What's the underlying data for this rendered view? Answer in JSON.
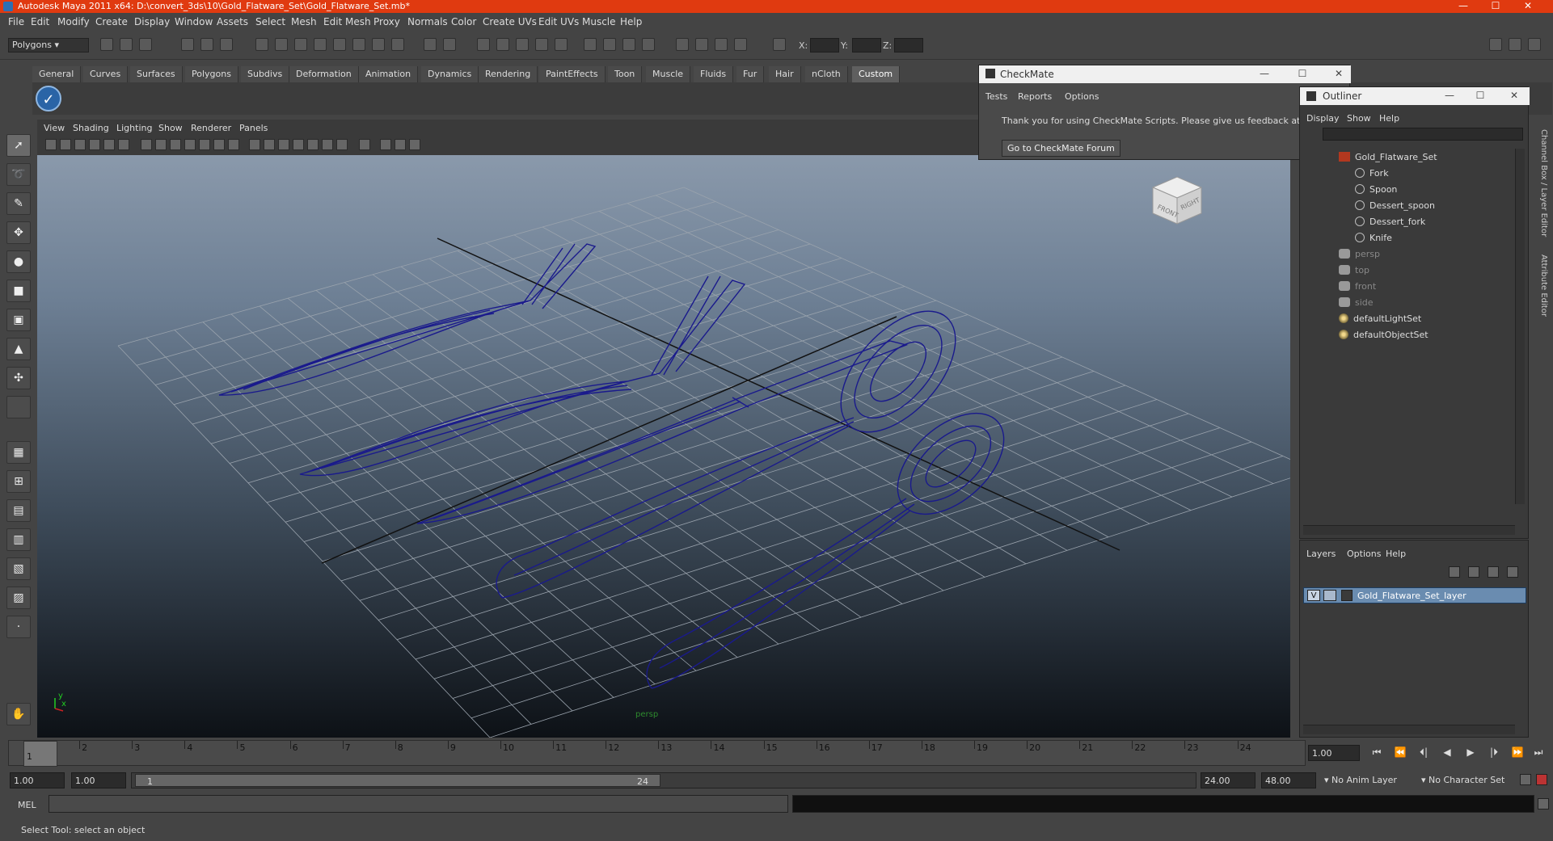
{
  "window": {
    "title": "Autodesk Maya 2011 x64: D:\\convert_3ds\\10\\Gold_Flatware_Set\\Gold_Flatware_Set.mb*",
    "minimize": "—",
    "maximize": "☐",
    "close": "✕"
  },
  "menubar": [
    "File",
    "Edit",
    "Modify",
    "Create",
    "Display",
    "Window",
    "Assets",
    "Select",
    "Mesh",
    "Edit Mesh",
    "Proxy",
    "Normals",
    "Color",
    "Create UVs",
    "Edit UVs",
    "Muscle",
    "Help"
  ],
  "statusline": {
    "mode": "Polygons",
    "x_label": "X:",
    "y_label": "Y:",
    "z_label": "Z:"
  },
  "shelf_tabs": [
    "General",
    "Curves",
    "Surfaces",
    "Polygons",
    "Subdivs",
    "Deformation",
    "Animation",
    "Dynamics",
    "Rendering",
    "PaintEffects",
    "Toon",
    "Muscle",
    "Fluids",
    "Fur",
    "Hair",
    "nCloth",
    "Custom"
  ],
  "shelf_active": "Custom",
  "viewport": {
    "menu": [
      "View",
      "Shading",
      "Lighting",
      "Show",
      "Renderer",
      "Panels"
    ],
    "camera_label": "persp",
    "viewcube_front": "FRONT",
    "viewcube_right": "RIGHT",
    "axis_y": "y",
    "axis_x": "x"
  },
  "checkmate": {
    "title": "CheckMate",
    "menu": [
      "Tests",
      "Reports",
      "Options"
    ],
    "message": "Thank you for using CheckMate Scripts. Please give us feedback at the Chec",
    "button": "Go to CheckMate Forum"
  },
  "outliner": {
    "title": "Outliner",
    "menu": [
      "Display",
      "Show",
      "Help"
    ],
    "items": [
      {
        "label": "Gold_Flatware_Set",
        "type": "grp",
        "depth": 0,
        "dim": false
      },
      {
        "label": "Fork",
        "type": "xform",
        "depth": 1,
        "dim": false
      },
      {
        "label": "Spoon",
        "type": "xform",
        "depth": 1,
        "dim": false
      },
      {
        "label": "Dessert_spoon",
        "type": "xform",
        "depth": 1,
        "dim": false
      },
      {
        "label": "Dessert_fork",
        "type": "xform",
        "depth": 1,
        "dim": false
      },
      {
        "label": "Knife",
        "type": "xform",
        "depth": 1,
        "dim": false
      },
      {
        "label": "persp",
        "type": "cam",
        "depth": 0,
        "dim": true
      },
      {
        "label": "top",
        "type": "cam",
        "depth": 0,
        "dim": true
      },
      {
        "label": "front",
        "type": "cam",
        "depth": 0,
        "dim": true
      },
      {
        "label": "side",
        "type": "cam",
        "depth": 0,
        "dim": true
      },
      {
        "label": "defaultLightSet",
        "type": "set",
        "depth": 0,
        "dim": false
      },
      {
        "label": "defaultObjectSet",
        "type": "set",
        "depth": 0,
        "dim": false
      }
    ]
  },
  "layers": {
    "menu": [
      "Layers",
      "Options",
      "Help"
    ],
    "layer_visible": "V",
    "layer_name": "Gold_Flatware_Set_layer"
  },
  "sidetabs": [
    "Channel Box / Layer Editor",
    "Attribute Editor"
  ],
  "timeslider": {
    "ticks": [
      "1",
      "2",
      "3",
      "4",
      "5",
      "6",
      "7",
      "8",
      "9",
      "10",
      "11",
      "12",
      "13",
      "14",
      "15",
      "16",
      "17",
      "18",
      "19",
      "20",
      "21",
      "22",
      "23",
      "24"
    ],
    "current_frame_marker": "1",
    "current_frame": "1.00"
  },
  "playback": {
    "buttons": [
      "⏮",
      "⏪",
      "⏴|",
      "◀",
      "▶",
      "|⏵",
      "⏩",
      "⏭"
    ]
  },
  "range": {
    "start": "1.00",
    "anim_start": "1.00",
    "range_min_label": "1",
    "range_max_label": "24",
    "anim_end": "24.00",
    "end": "48.00",
    "anim_layer": "No Anim Layer",
    "character_set": "No Character Set"
  },
  "commandline": {
    "label": "MEL"
  },
  "helpline": {
    "text": "Select Tool: select an object"
  },
  "colors": {
    "titlebar": "#e03a10",
    "wireframe": "#1a1a8c",
    "layer_highlight": "#6a8cb0"
  }
}
